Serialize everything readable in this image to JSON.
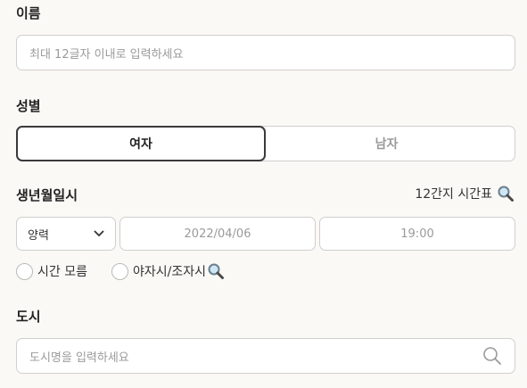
{
  "name": {
    "label": "이름",
    "placeholder": "최대 12글자 이내로 입력하세요"
  },
  "gender": {
    "label": "성별",
    "options": [
      "여자",
      "남자"
    ],
    "selected": "여자"
  },
  "birth": {
    "label": "생년월일시",
    "zodiac_link": "12간지 시간표",
    "calendar_select": "양력",
    "date": "2022/04/06",
    "time": "19:00",
    "unknown_time": "시간 모름",
    "night_time": "야자시/조자시"
  },
  "city": {
    "label": "도시",
    "placeholder": "도시명을 입력하세요"
  }
}
